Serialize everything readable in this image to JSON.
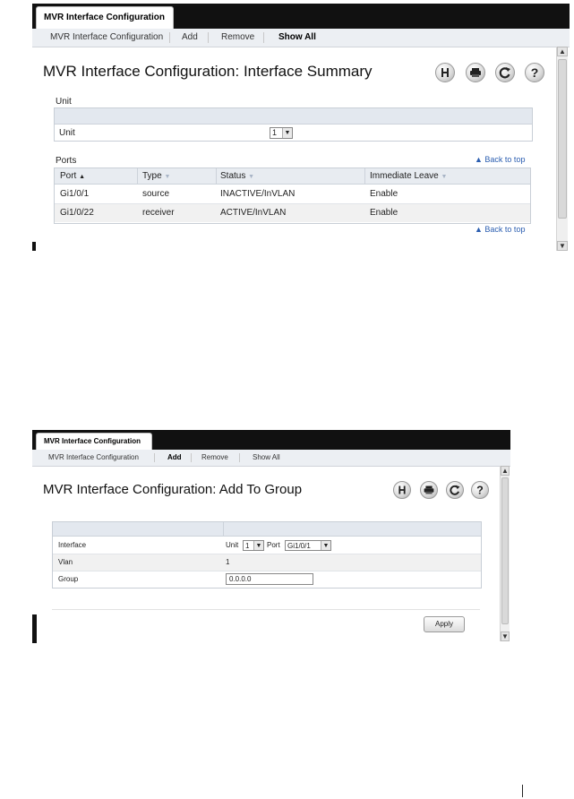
{
  "screen1": {
    "top_tab": "MVR Interface Configuration",
    "subnav": [
      {
        "label": "MVR Interface Configuration"
      },
      {
        "label": "Add"
      },
      {
        "label": "Remove"
      },
      {
        "label": "Show All"
      }
    ],
    "title": "MVR Interface Configuration: Interface Summary",
    "unit_section": {
      "heading": "Unit",
      "label": "Unit",
      "value": "1"
    },
    "ports_section": {
      "heading": "Ports",
      "back_to_top": "Back to top",
      "columns": [
        "Port",
        "Type",
        "Status",
        "Immediate Leave"
      ],
      "rows": [
        [
          "Gi1/0/1",
          "source",
          "INACTIVE/InVLAN",
          "Enable"
        ],
        [
          "Gi1/0/22",
          "receiver",
          "ACTIVE/InVLAN",
          "Enable"
        ]
      ]
    },
    "back_to_top_bottom": "Back to top",
    "icons": [
      "save-icon",
      "print-icon",
      "refresh-icon",
      "help-icon"
    ]
  },
  "screen2": {
    "top_tab": "MVR Interface Configuration",
    "subnav": [
      {
        "label": "MVR Interface Configuration"
      },
      {
        "label": "Add"
      },
      {
        "label": "Remove"
      },
      {
        "label": "Show All"
      }
    ],
    "title": "MVR Interface Configuration: Add To Group",
    "form": {
      "interface_label": "Interface",
      "unit_label": "Unit",
      "unit_value": "1",
      "port_label": "Port",
      "port_value": "Gi1/0/1",
      "vlan_label": "Vlan",
      "vlan_value": "1",
      "group_label": "Group",
      "group_value": "0.0.0.0"
    },
    "apply_label": "Apply",
    "icons": [
      "save-icon",
      "print-icon",
      "refresh-icon",
      "help-icon"
    ]
  }
}
